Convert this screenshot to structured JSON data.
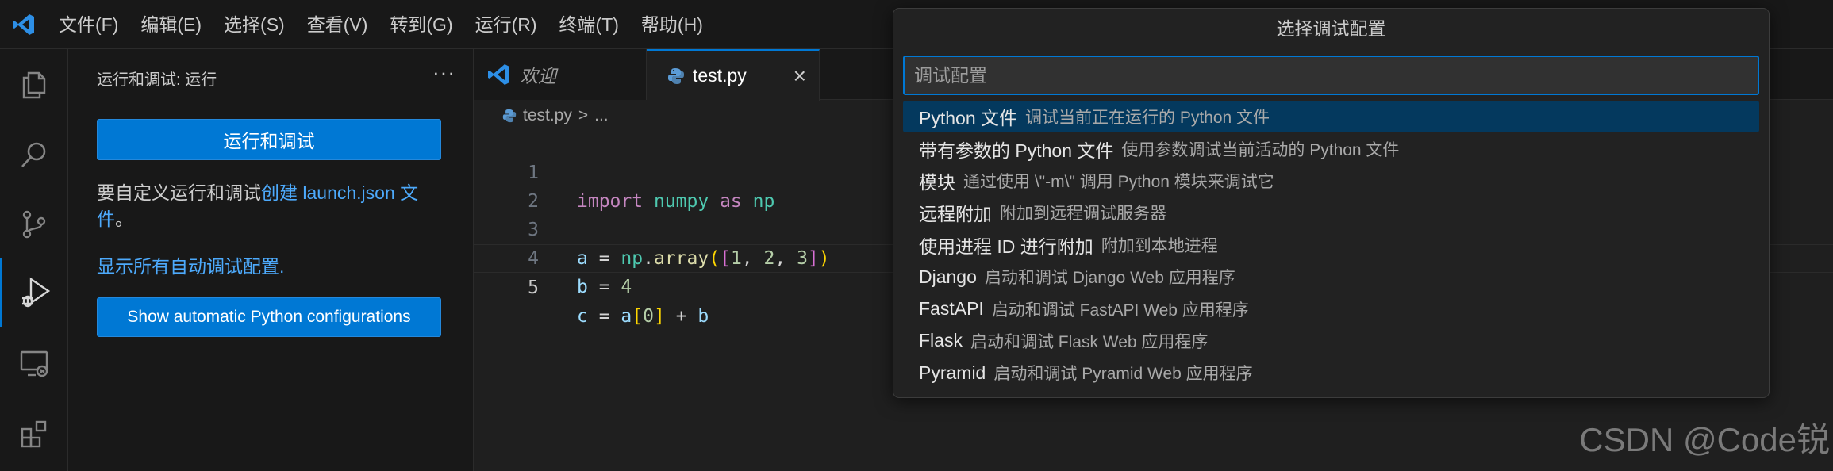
{
  "menu": [
    "文件(F)",
    "编辑(E)",
    "选择(S)",
    "查看(V)",
    "转到(G)",
    "运行(R)",
    "终端(T)",
    "帮助(H)"
  ],
  "sidebar": {
    "header": "运行和调试: 运行",
    "more": "···",
    "run_button": "运行和调试",
    "text_prefix": "要自定义运行和调试",
    "text_link": "创建 launch.json 文件",
    "text_suffix": "。",
    "show_all_link": "显示所有自动调试配置",
    "show_all_suffix": ".",
    "auto_button": "Show automatic Python configurations"
  },
  "tabs": {
    "welcome": "欢迎",
    "test": "test.py",
    "close": "×"
  },
  "breadcrumb": {
    "file": "test.py",
    "separator": ">",
    "rest": "..."
  },
  "code": {
    "line_numbers": [
      "1",
      "2",
      "3",
      "4",
      "5"
    ],
    "l1_kw": "import",
    "l1_mod": "numpy",
    "l1_as": "as",
    "l1_alias": "np",
    "l3_a": "a",
    "l3_eq": " = ",
    "l3_np": "np",
    "l3_dot": ".",
    "l3_fn": "array",
    "l3_p1": "(",
    "l3_b1": "[",
    "l3_n1": "1",
    "l3_c1": ", ",
    "l3_n2": "2",
    "l3_c2": ", ",
    "l3_n3": "3",
    "l3_b2": "]",
    "l3_p2": ")",
    "l4_b": "b",
    "l4_eq": " = ",
    "l4_n": "4",
    "l5_c": "c",
    "l5_eq": " = ",
    "l5_a": "a",
    "l5_b1": "[",
    "l5_n": "0",
    "l5_b2": "]",
    "l5_plus": " + ",
    "l5_b": "b"
  },
  "quickpick": {
    "title": "选择调试配置",
    "placeholder": "调试配置",
    "items": [
      {
        "label": "Python 文件",
        "desc": "调试当前正在运行的 Python 文件"
      },
      {
        "label": "带有参数的 Python 文件",
        "desc": "使用参数调试当前活动的 Python 文件"
      },
      {
        "label": "模块",
        "desc": "通过使用 \\\"-m\\\" 调用 Python 模块来调试它"
      },
      {
        "label": "远程附加",
        "desc": "附加到远程调试服务器"
      },
      {
        "label": "使用进程 ID 进行附加",
        "desc": "附加到本地进程"
      },
      {
        "label": "Django",
        "desc": "启动和调试 Django Web 应用程序"
      },
      {
        "label": "FastAPI",
        "desc": "启动和调试 FastAPI Web 应用程序"
      },
      {
        "label": "Flask",
        "desc": "启动和调试 Flask Web 应用程序"
      },
      {
        "label": "Pyramid",
        "desc": "启动和调试 Pyramid Web 应用程序"
      }
    ]
  },
  "watermark": "CSDN @Code锐",
  "colors": {
    "accent": "#0078d4",
    "link": "#4daafc",
    "selected_item": "#04395e",
    "background": "#1f1f1f"
  },
  "icons": [
    "vscode-logo-icon",
    "explorer-icon",
    "search-icon",
    "source-control-icon",
    "run-debug-icon",
    "remote-explorer-icon",
    "extensions-icon",
    "python-file-icon",
    "close-icon"
  ]
}
